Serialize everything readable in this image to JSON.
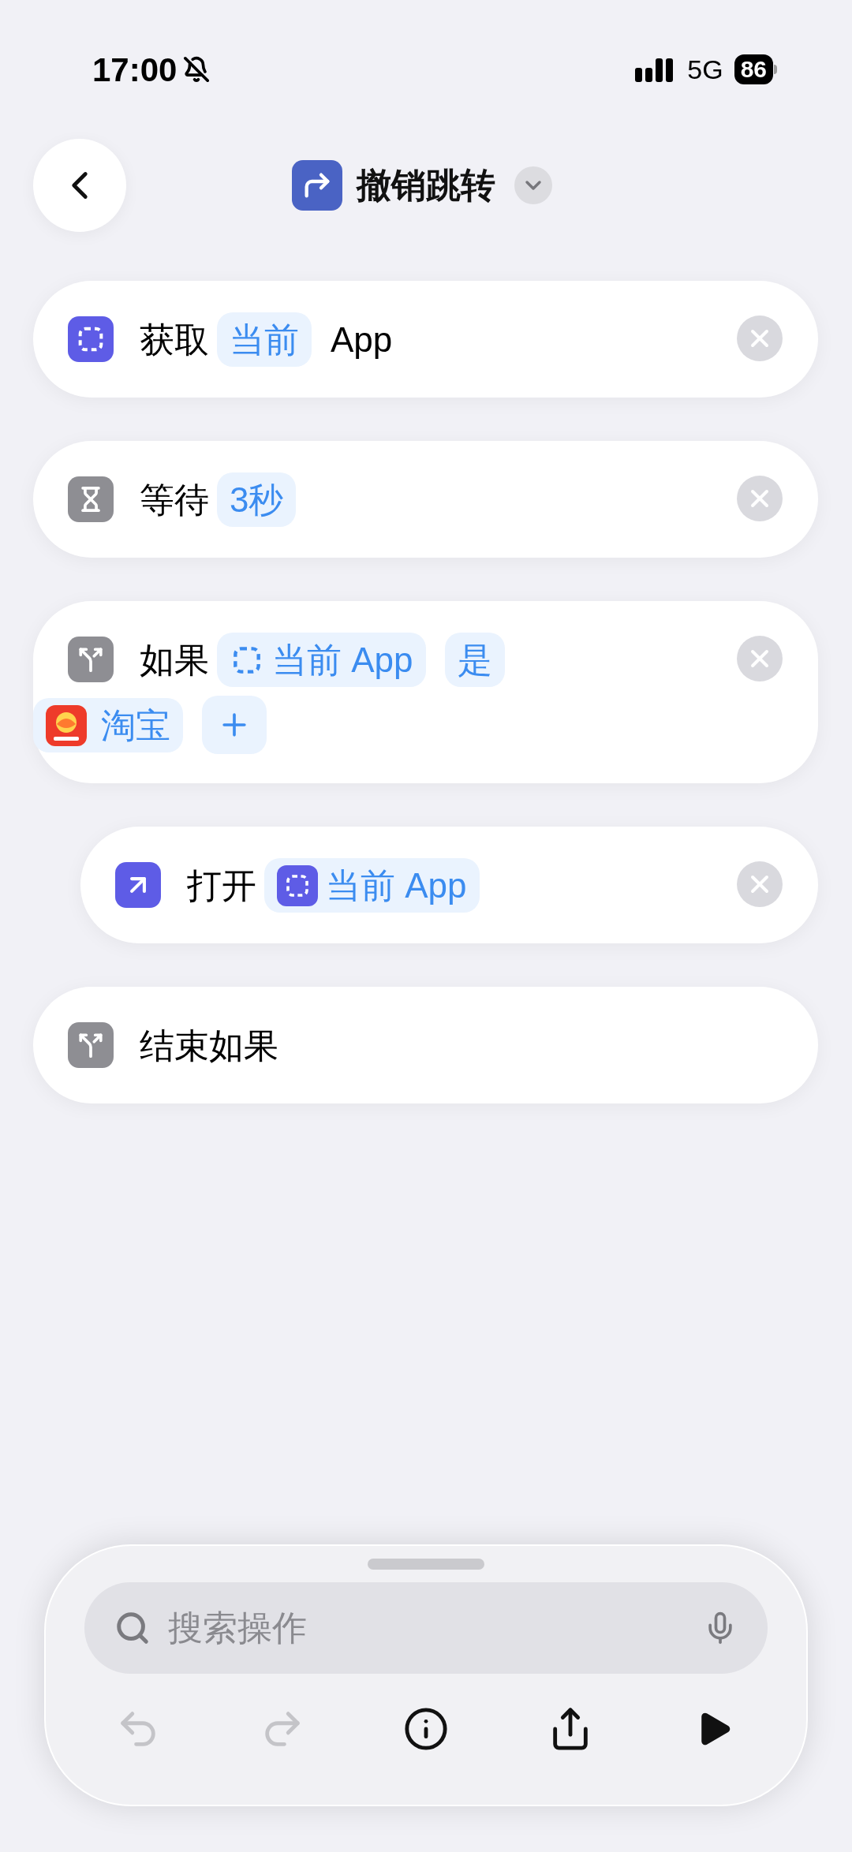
{
  "status_bar": {
    "time": "17:00",
    "silent": true,
    "network": "5G",
    "battery": "86"
  },
  "header": {
    "title": "撤销跳转"
  },
  "actions": [
    {
      "kind": "get-app",
      "nested": false,
      "removable": true,
      "parts": [
        {
          "kind": "text",
          "text": "获取"
        },
        {
          "kind": "token",
          "text": "当前"
        },
        {
          "kind": "text",
          "text": "App"
        }
      ]
    },
    {
      "kind": "wait",
      "nested": false,
      "removable": true,
      "parts": [
        {
          "kind": "text",
          "text": "等待"
        },
        {
          "kind": "token",
          "text": "3秒"
        }
      ]
    },
    {
      "kind": "if",
      "nested": false,
      "removable": true,
      "parts": [
        {
          "kind": "text",
          "text": "如果"
        },
        {
          "kind": "variable-token",
          "text": "当前 App"
        },
        {
          "kind": "token",
          "text": "是"
        },
        {
          "kind": "app-token",
          "text": "淘宝"
        },
        {
          "kind": "add"
        }
      ]
    },
    {
      "kind": "open",
      "nested": true,
      "removable": true,
      "parts": [
        {
          "kind": "text",
          "text": "打开"
        },
        {
          "kind": "magic-variable-token",
          "text": "当前 App"
        }
      ]
    },
    {
      "kind": "if",
      "nested": false,
      "removable": false,
      "parts": [
        {
          "kind": "text",
          "text": "结束如果"
        }
      ]
    }
  ],
  "search": {
    "placeholder": "搜索操作"
  },
  "toolbar": [
    {
      "kind": "undo",
      "disabled": true
    },
    {
      "kind": "redo",
      "disabled": true
    },
    {
      "kind": "info",
      "disabled": false
    },
    {
      "kind": "share",
      "disabled": false
    },
    {
      "kind": "run",
      "disabled": false
    }
  ]
}
